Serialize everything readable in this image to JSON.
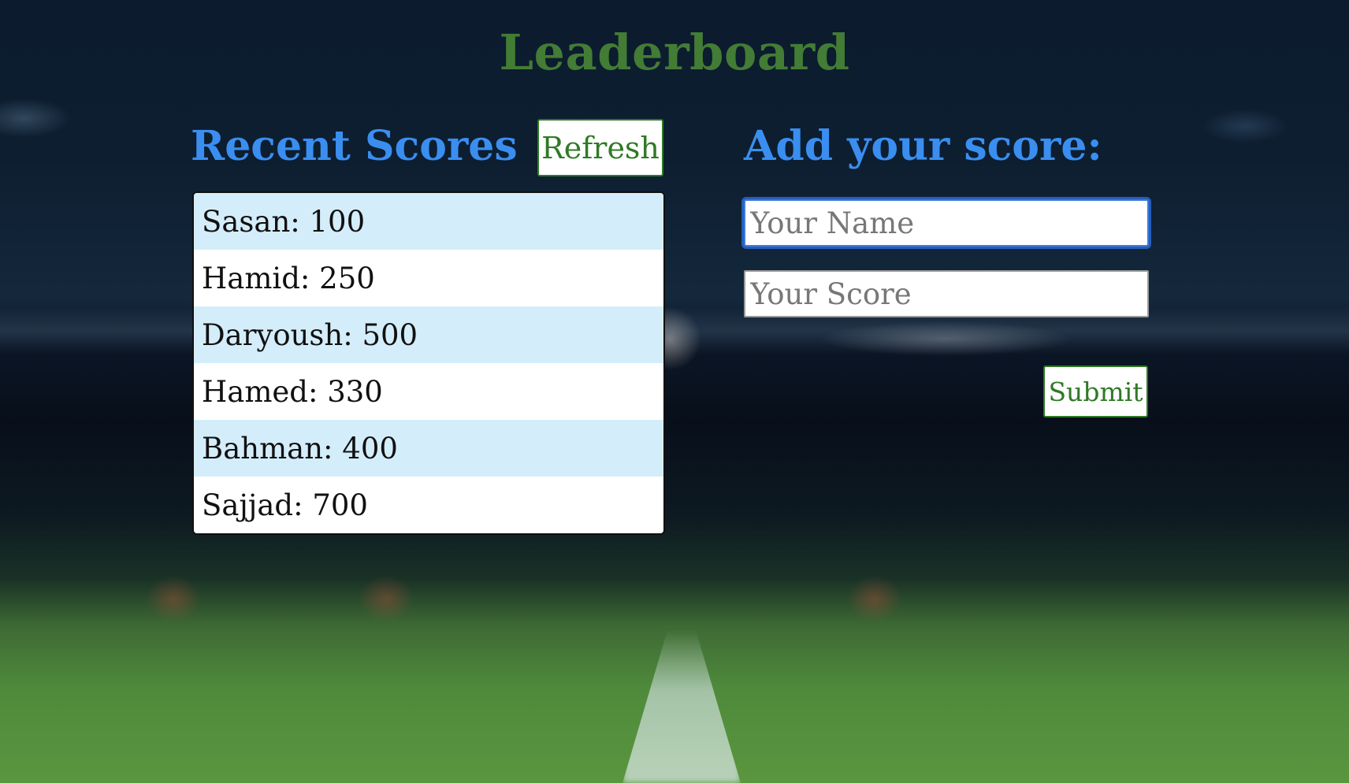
{
  "page": {
    "title": "Leaderboard"
  },
  "recent_scores": {
    "heading": "Recent Scores",
    "refresh_label": "Refresh",
    "entries": [
      "Sasan: 100",
      "Hamid: 250",
      "Daryoush: 500",
      "Hamed: 330",
      "Bahman: 400",
      "Sajjad: 700"
    ]
  },
  "add_score": {
    "heading": "Add your score:",
    "name_placeholder": "Your Name",
    "score_placeholder": "Your Score",
    "submit_label": "Submit"
  },
  "colors": {
    "title": "#437c35",
    "heading": "#3a8ef0",
    "button_text": "#2f7a25",
    "row_highlight": "#d4edfa"
  }
}
